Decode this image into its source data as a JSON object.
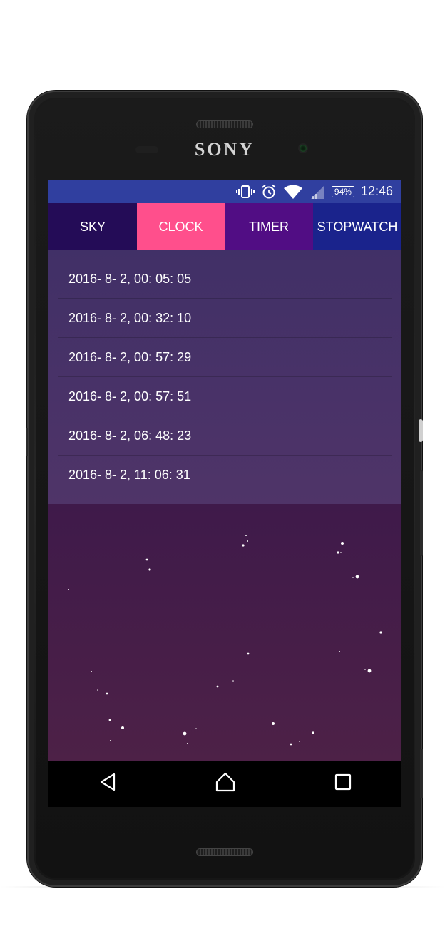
{
  "device": {
    "brand": "SONY"
  },
  "statusbar": {
    "icons": [
      "vibrate-icon",
      "alarm-icon",
      "wifi-icon",
      "signal-icon"
    ],
    "battery": "94%",
    "time": "12:46"
  },
  "tabs": [
    {
      "label": "SKY",
      "color": "#240c57"
    },
    {
      "label": "CLOCK",
      "color": "#ff4f8c",
      "selected": true
    },
    {
      "label": "TIMER",
      "color": "#510d84"
    },
    {
      "label": "STOPWATCH",
      "color": "#1a238c"
    }
  ],
  "records": [
    "2016- 8- 2, 00: 05: 05",
    "2016- 8- 2, 00: 32: 10",
    "2016- 8- 2, 00: 57: 29",
    "2016- 8- 2, 00: 57: 51",
    "2016- 8- 2, 06: 48: 23",
    "2016- 8- 2, 11: 06: 31"
  ],
  "navbar": {
    "icons": [
      "back-icon",
      "home-icon",
      "recents-icon"
    ]
  },
  "colors": {
    "statusbar": "#303f9f",
    "list_panel": "#47306a",
    "sky_background": "#3a1648",
    "navbar": "#000000"
  }
}
